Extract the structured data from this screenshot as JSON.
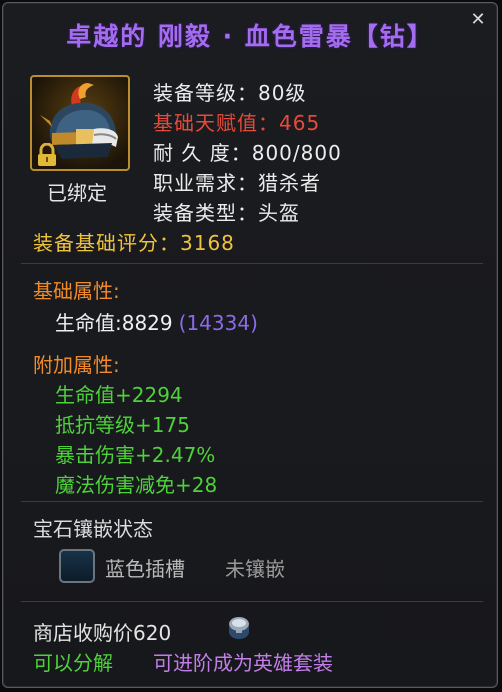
{
  "item": {
    "title": "卓越的 刚毅 · 血色雷暴【钻】",
    "bound_status": "已绑定",
    "equip_level": "装备等级：80级",
    "talent": "基础天赋值：465",
    "durability": "耐 久 度：800/800",
    "class_req": "职业需求：猎杀者",
    "equip_type": "装备类型：头盔",
    "base_score": "装备基础评分：3168"
  },
  "base_attributes": {
    "title": "基础属性:",
    "hp_label": "生命值:8829",
    "hp_paren": "(14334)"
  },
  "extra_attributes": {
    "title": "附加属性:",
    "items": [
      "生命值+2294",
      "抵抗等级+175",
      "暴击伤害+2.47%",
      "魔法伤害减免+28"
    ]
  },
  "gem": {
    "title": "宝石镶嵌状态",
    "slot_label": "蓝色插槽",
    "slot_state": "未镶嵌"
  },
  "footer": {
    "price": "商店收购价620",
    "decompose": "可以分解",
    "upgrade": "可进阶成为英雄套装"
  },
  "colors": {
    "title": "#a46cf0",
    "talent": "#e64a3a",
    "score": "#f0c33c",
    "section": "#f08a2a",
    "attr": "#4ed23a",
    "upgrade": "#c27ee8"
  },
  "icons": {
    "close": "close-icon",
    "item": "helmet-icon",
    "lock": "lock-icon",
    "coin": "coin-icon"
  }
}
